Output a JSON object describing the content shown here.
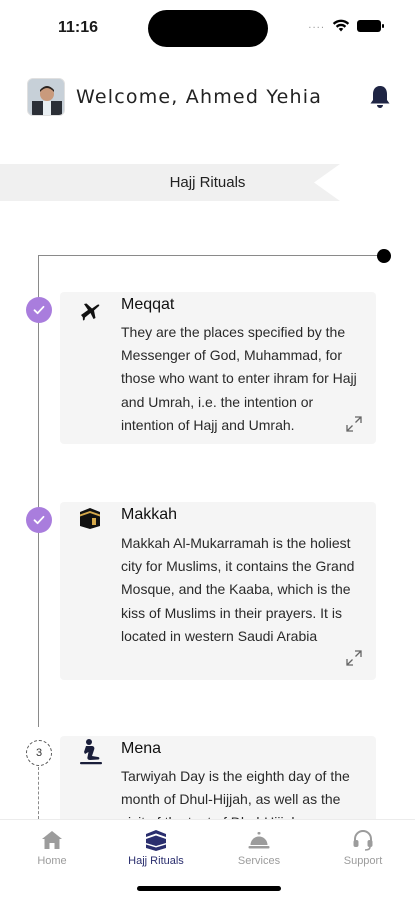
{
  "status_bar": {
    "time": "11:16",
    "signal_dots": "....",
    "wifi_icon": "wifi-icon",
    "battery_icon": "battery-icon"
  },
  "header": {
    "welcome_text": "Welcome, Ahmed Yehia",
    "avatar_icon": "user-avatar",
    "bell_icon": "bell-icon"
  },
  "page_title": "Hajj Rituals",
  "steps": [
    {
      "status": "completed",
      "icon": "airplane-icon",
      "title": "Meqqat",
      "description": "They are the places specified by the Messenger of God, Muhammad, for those who want to enter ihram for Hajj and Umrah, i.e. the intention or intention of Hajj and Umrah."
    },
    {
      "status": "completed",
      "icon": "kaaba-icon",
      "title": "Makkah",
      "description": "Makkah Al-Mukarramah is the holiest city for Muslims, it contains the Grand Mosque, and the Kaaba, which is the kiss of Muslims in their prayers. It is located in western Saudi Arabia"
    },
    {
      "status": "pending",
      "number": "3",
      "icon": "praying-person-icon",
      "title": "Mena",
      "description": "Tarwiyah Day is the eighth day of the month of Dhul-Hijjah, as well as the visit of the tent of Dhul-Hijjah"
    }
  ],
  "bottom_nav": [
    {
      "label": "Home",
      "icon": "home-icon",
      "active": false
    },
    {
      "label": "Hajj Rituals",
      "icon": "kaaba-icon",
      "active": true
    },
    {
      "label": "Services",
      "icon": "service-bell-icon",
      "active": false
    },
    {
      "label": "Support",
      "icon": "headset-icon",
      "active": false
    }
  ],
  "colors": {
    "accent_purple": "#a97ddd",
    "active_nav": "#2a2e6e",
    "inactive_nav": "#9c9c9c",
    "card_bg": "#f5f5f5"
  }
}
